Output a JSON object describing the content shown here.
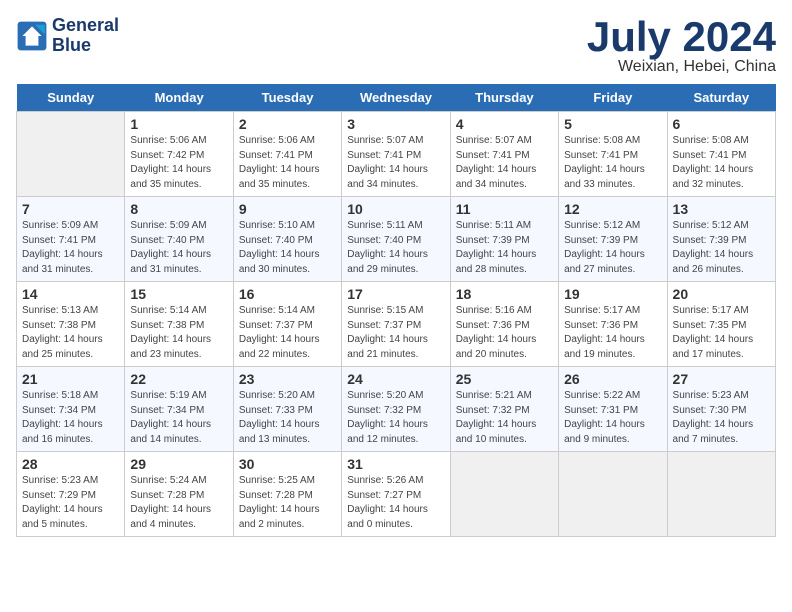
{
  "logo": {
    "line1": "General",
    "line2": "Blue"
  },
  "title": "July 2024",
  "subtitle": "Weixian, Hebei, China",
  "days_of_week": [
    "Sunday",
    "Monday",
    "Tuesday",
    "Wednesday",
    "Thursday",
    "Friday",
    "Saturday"
  ],
  "weeks": [
    [
      {
        "day": null
      },
      {
        "day": "1",
        "sunrise": "5:06 AM",
        "sunset": "7:42 PM",
        "daylight": "14 hours and 35 minutes."
      },
      {
        "day": "2",
        "sunrise": "5:06 AM",
        "sunset": "7:41 PM",
        "daylight": "14 hours and 35 minutes."
      },
      {
        "day": "3",
        "sunrise": "5:07 AM",
        "sunset": "7:41 PM",
        "daylight": "14 hours and 34 minutes."
      },
      {
        "day": "4",
        "sunrise": "5:07 AM",
        "sunset": "7:41 PM",
        "daylight": "14 hours and 34 minutes."
      },
      {
        "day": "5",
        "sunrise": "5:08 AM",
        "sunset": "7:41 PM",
        "daylight": "14 hours and 33 minutes."
      },
      {
        "day": "6",
        "sunrise": "5:08 AM",
        "sunset": "7:41 PM",
        "daylight": "14 hours and 32 minutes."
      }
    ],
    [
      {
        "day": "7",
        "sunrise": "5:09 AM",
        "sunset": "7:41 PM",
        "daylight": "14 hours and 31 minutes."
      },
      {
        "day": "8",
        "sunrise": "5:09 AM",
        "sunset": "7:40 PM",
        "daylight": "14 hours and 31 minutes."
      },
      {
        "day": "9",
        "sunrise": "5:10 AM",
        "sunset": "7:40 PM",
        "daylight": "14 hours and 30 minutes."
      },
      {
        "day": "10",
        "sunrise": "5:11 AM",
        "sunset": "7:40 PM",
        "daylight": "14 hours and 29 minutes."
      },
      {
        "day": "11",
        "sunrise": "5:11 AM",
        "sunset": "7:39 PM",
        "daylight": "14 hours and 28 minutes."
      },
      {
        "day": "12",
        "sunrise": "5:12 AM",
        "sunset": "7:39 PM",
        "daylight": "14 hours and 27 minutes."
      },
      {
        "day": "13",
        "sunrise": "5:12 AM",
        "sunset": "7:39 PM",
        "daylight": "14 hours and 26 minutes."
      }
    ],
    [
      {
        "day": "14",
        "sunrise": "5:13 AM",
        "sunset": "7:38 PM",
        "daylight": "14 hours and 25 minutes."
      },
      {
        "day": "15",
        "sunrise": "5:14 AM",
        "sunset": "7:38 PM",
        "daylight": "14 hours and 23 minutes."
      },
      {
        "day": "16",
        "sunrise": "5:14 AM",
        "sunset": "7:37 PM",
        "daylight": "14 hours and 22 minutes."
      },
      {
        "day": "17",
        "sunrise": "5:15 AM",
        "sunset": "7:37 PM",
        "daylight": "14 hours and 21 minutes."
      },
      {
        "day": "18",
        "sunrise": "5:16 AM",
        "sunset": "7:36 PM",
        "daylight": "14 hours and 20 minutes."
      },
      {
        "day": "19",
        "sunrise": "5:17 AM",
        "sunset": "7:36 PM",
        "daylight": "14 hours and 19 minutes."
      },
      {
        "day": "20",
        "sunrise": "5:17 AM",
        "sunset": "7:35 PM",
        "daylight": "14 hours and 17 minutes."
      }
    ],
    [
      {
        "day": "21",
        "sunrise": "5:18 AM",
        "sunset": "7:34 PM",
        "daylight": "14 hours and 16 minutes."
      },
      {
        "day": "22",
        "sunrise": "5:19 AM",
        "sunset": "7:34 PM",
        "daylight": "14 hours and 14 minutes."
      },
      {
        "day": "23",
        "sunrise": "5:20 AM",
        "sunset": "7:33 PM",
        "daylight": "14 hours and 13 minutes."
      },
      {
        "day": "24",
        "sunrise": "5:20 AM",
        "sunset": "7:32 PM",
        "daylight": "14 hours and 12 minutes."
      },
      {
        "day": "25",
        "sunrise": "5:21 AM",
        "sunset": "7:32 PM",
        "daylight": "14 hours and 10 minutes."
      },
      {
        "day": "26",
        "sunrise": "5:22 AM",
        "sunset": "7:31 PM",
        "daylight": "14 hours and 9 minutes."
      },
      {
        "day": "27",
        "sunrise": "5:23 AM",
        "sunset": "7:30 PM",
        "daylight": "14 hours and 7 minutes."
      }
    ],
    [
      {
        "day": "28",
        "sunrise": "5:23 AM",
        "sunset": "7:29 PM",
        "daylight": "14 hours and 5 minutes."
      },
      {
        "day": "29",
        "sunrise": "5:24 AM",
        "sunset": "7:28 PM",
        "daylight": "14 hours and 4 minutes."
      },
      {
        "day": "30",
        "sunrise": "5:25 AM",
        "sunset": "7:28 PM",
        "daylight": "14 hours and 2 minutes."
      },
      {
        "day": "31",
        "sunrise": "5:26 AM",
        "sunset": "7:27 PM",
        "daylight": "14 hours and 0 minutes."
      },
      {
        "day": null
      },
      {
        "day": null
      },
      {
        "day": null
      }
    ]
  ],
  "labels": {
    "sunrise": "Sunrise:",
    "sunset": "Sunset:",
    "daylight": "Daylight:"
  }
}
